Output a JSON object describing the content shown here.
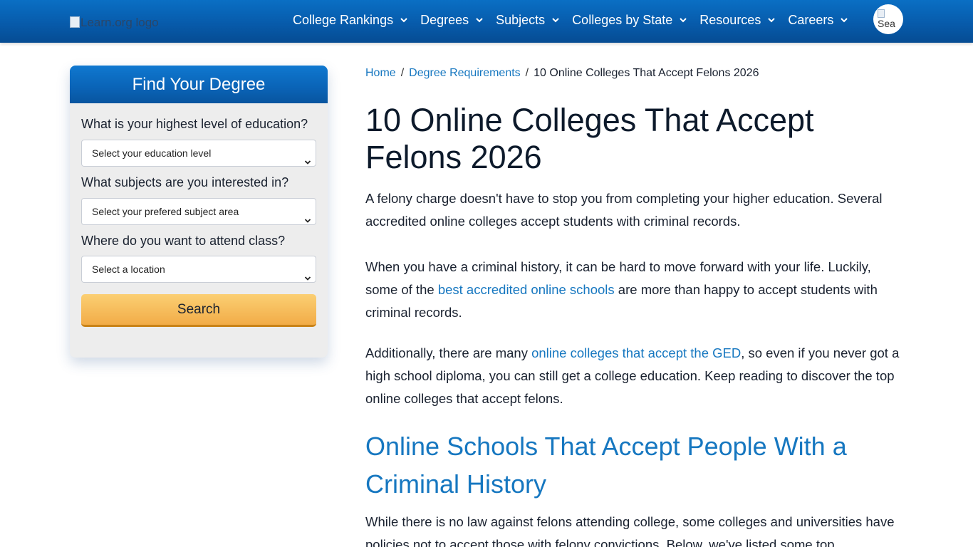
{
  "header": {
    "logo_alt": "Learn.org logo",
    "nav": [
      {
        "label": "College Rankings"
      },
      {
        "label": "Degrees"
      },
      {
        "label": "Subjects"
      },
      {
        "label": "Colleges by State"
      },
      {
        "label": "Resources"
      },
      {
        "label": "Careers"
      }
    ],
    "search_alt": "Sea"
  },
  "finder": {
    "title": "Find Your Degree",
    "questions": [
      {
        "label": "What is your highest level of education?",
        "placeholder": "Select your education level"
      },
      {
        "label": "What subjects are you interested in?",
        "placeholder": "Select your prefered subject area"
      },
      {
        "label": "Where do you want to attend class?",
        "placeholder": "Select a location"
      }
    ],
    "search_label": "Search"
  },
  "breadcrumb": {
    "home": "Home",
    "section": "Degree Requirements",
    "current": "10 Online Colleges That Accept Felons 2026",
    "separator": "/"
  },
  "article": {
    "title": "10 Online Colleges That Accept Felons 2026",
    "intro": "A felony charge doesn't have to stop you from completing your higher education. Several accredited online colleges accept students with criminal records.",
    "p2_before": "When you have a criminal history, it can be hard to move forward with your life. Luckily, some of the ",
    "p2_link": "best accredited online schools",
    "p2_after": " are more than happy to accept students with criminal records.",
    "p3_before": "Additionally, there are many ",
    "p3_link": "online colleges that accept the GED",
    "p3_after": ", so even if you never got a high school diploma, you can still get a college education. Keep reading to discover the top online colleges that accept felons.",
    "h2": "Online Schools That Accept People With a Criminal History",
    "p4": "While there is no law against felons attending college, some colleges and universities have policies not to accept those with felony convictions. Below, we've listed some top"
  },
  "colors": {
    "header_blue": "#075bab",
    "link_blue": "#1677c0",
    "button_orange": "#f2ac48",
    "panel_gray": "#ededed"
  },
  "icons": [
    "chevron-down-icon",
    "broken-image-icon"
  ]
}
